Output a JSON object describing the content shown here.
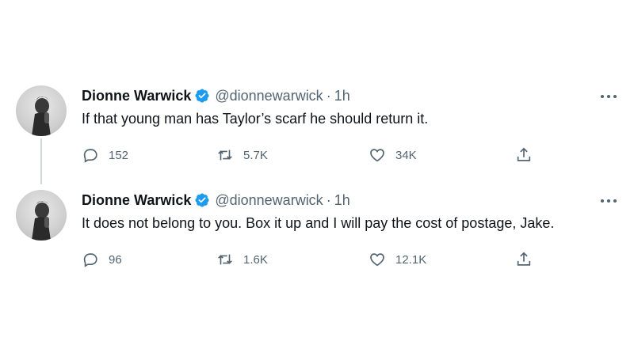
{
  "tweets": [
    {
      "author_name": "Dionne Warwick",
      "handle": "@dionnewarwick",
      "separator": "·",
      "time": "1h",
      "text": "If that young man has Taylor’s scarf he should return it.",
      "replies": "152",
      "retweets": "5.7K",
      "likes": "34K"
    },
    {
      "author_name": "Dionne Warwick",
      "handle": "@dionnewarwick",
      "separator": "·",
      "time": "1h",
      "text": "It does not belong to you. Box it up and I will pay the cost of postage, Jake.",
      "replies": "96",
      "retweets": "1.6K",
      "likes": "12.1K"
    }
  ],
  "colors": {
    "text": "#0f1419",
    "secondary": "#536471",
    "verified": "#1d9bf0",
    "thread_line": "#cfd9de"
  },
  "icons": {
    "reply": "reply-icon",
    "retweet": "retweet-icon",
    "like": "heart-icon",
    "share": "share-icon",
    "verified": "verified-badge-icon",
    "more": "more-icon"
  }
}
